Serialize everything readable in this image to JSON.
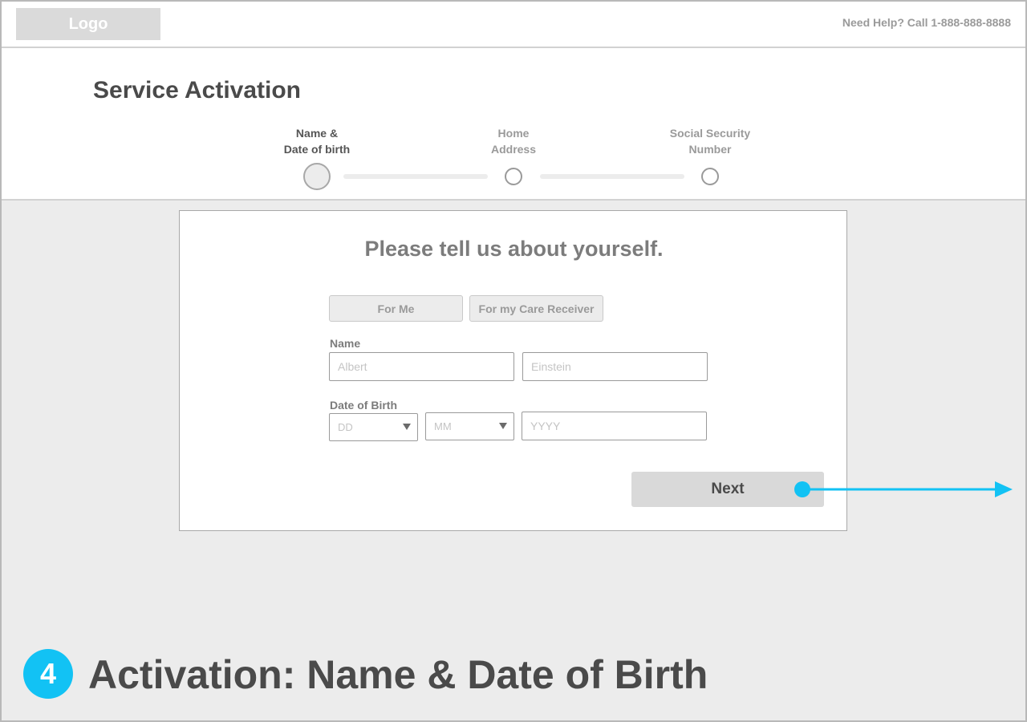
{
  "topbar": {
    "logo": "Logo",
    "help": "Need Help? Call 1-888-888-8888"
  },
  "header": {
    "title": "Service Activation",
    "steps": [
      {
        "line1": "Name &",
        "line2": "Date of birth",
        "active": true
      },
      {
        "line1": "Home",
        "line2": "Address",
        "active": false
      },
      {
        "line1": "Social Security",
        "line2": "Number",
        "active": false
      }
    ]
  },
  "form": {
    "heading": "Please tell us about yourself.",
    "toggle_me": "For Me",
    "toggle_care": "For my Care Receiver",
    "name_label": "Name",
    "first_name_placeholder": "Albert",
    "last_name_placeholder": "Einstein",
    "dob_label": "Date of Birth",
    "day_placeholder": "DD",
    "month_placeholder": "MM",
    "year_placeholder": "YYYY",
    "next_label": "Next"
  },
  "annotation": {
    "number": "4",
    "title": "Activation: Name & Date of Birth",
    "accent_color": "#12c2f4"
  }
}
